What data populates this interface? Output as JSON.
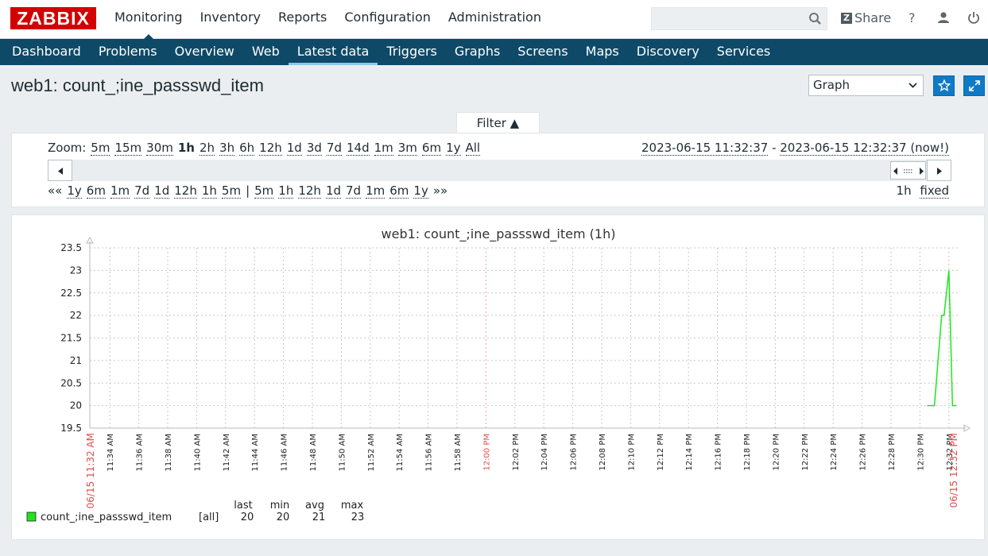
{
  "logo": "ZABBIX",
  "top_nav": [
    "Monitoring",
    "Inventory",
    "Reports",
    "Configuration",
    "Administration"
  ],
  "search": {
    "value": "",
    "placeholder": ""
  },
  "share_label": "Share",
  "help_label": "?",
  "sub_nav": [
    "Dashboard",
    "Problems",
    "Overview",
    "Web",
    "Latest data",
    "Triggers",
    "Graphs",
    "Screens",
    "Maps",
    "Discovery",
    "Services"
  ],
  "page_title": "web1: count_;ine_passswd_item",
  "view_select": "Graph",
  "filter_label": "Filter ▲",
  "zoom": {
    "label": "Zoom:",
    "options": [
      "5m",
      "15m",
      "30m",
      "1h",
      "2h",
      "3h",
      "6h",
      "12h",
      "1d",
      "3d",
      "7d",
      "14d",
      "1m",
      "3m",
      "6m",
      "1y",
      "All"
    ],
    "selected": "1h"
  },
  "date_range": {
    "from": "2023-06-15 11:32:37",
    "sep": " - ",
    "to": "2023-06-15 12:32:37 (now!)"
  },
  "nav": {
    "back": [
      "««",
      "1y",
      "6m",
      "1m",
      "7d",
      "1d",
      "12h",
      "1h",
      "5m"
    ],
    "separator": "|",
    "forward": [
      "5m",
      "1h",
      "12h",
      "1d",
      "7d",
      "1m",
      "6m",
      "1y",
      "»»"
    ]
  },
  "period": {
    "value": "1h",
    "mode": "fixed"
  },
  "colors": {
    "brand": "#d40000",
    "nav": "#0e4a67",
    "accent": "#0f7ac6",
    "series": "#1ee51e",
    "time_marker": "#e24d4d"
  },
  "chart_data": {
    "type": "line",
    "title": "web1: count_;ine_passswd_item (1h)",
    "ylim": [
      19.5,
      23.5
    ],
    "y_ticks": [
      "19.5",
      "20",
      "20.5",
      "21",
      "21.5",
      "22",
      "22.5",
      "23",
      "23.5"
    ],
    "x_ticks": [
      "11:34 AM",
      "11:36 AM",
      "11:38 AM",
      "11:40 AM",
      "11:42 AM",
      "11:44 AM",
      "11:46 AM",
      "11:48 AM",
      "11:50 AM",
      "11:52 AM",
      "11:54 AM",
      "11:56 AM",
      "11:58 AM",
      "12:00 PM",
      "12:02 PM",
      "12:04 PM",
      "12:06 PM",
      "12:08 PM",
      "12:10 PM",
      "12:12 PM",
      "12:14 PM",
      "12:16 PM",
      "12:18 PM",
      "12:20 PM",
      "12:22 PM",
      "12:24 PM",
      "12:26 PM",
      "12:28 PM",
      "12:30 PM",
      "12:32 PM"
    ],
    "x_start_label": "06/15 11:32 AM",
    "x_end_label": "06/15 12:32 PM",
    "highlight_tick": "12:00 PM",
    "grid": true,
    "series": [
      {
        "name": "count_;ine_passswd_item",
        "x": [
          "12:30:30",
          "12:31:00",
          "12:31:30",
          "12:31:40",
          "12:32:00",
          "12:32:15",
          "12:32:30"
        ],
        "values": [
          20,
          20,
          22,
          22,
          23,
          20,
          20
        ]
      }
    ],
    "legend": {
      "headers": [
        "last",
        "min",
        "avg",
        "max"
      ],
      "rows": [
        {
          "name": "count_;ine_passswd_item",
          "func": "[all]",
          "last": "20",
          "min": "20",
          "avg": "21",
          "max": "23"
        }
      ]
    }
  }
}
